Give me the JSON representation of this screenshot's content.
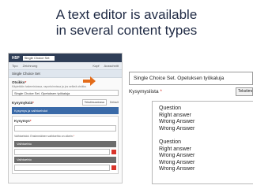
{
  "title": {
    "line1": "A text editor is available",
    "line2": "in several content types"
  },
  "thumbnail": {
    "logo": "H5P",
    "content_selector": "Single Choice Set",
    "toolbar": {
      "left": "Tipo",
      "middle": "Zeichnung",
      "right1": "Kopf",
      "right2": "Ausschnitt"
    },
    "header": "Single Choice Set",
    "title_label": "Otsikko",
    "title_hint": "Käytetään hakemistossa, raportoinnissa ja jos selkeä otsikko",
    "title_value": "Single Choice Set. Opetuksen työkaluja",
    "questions_label": "Kysymyksiä",
    "tab_text": "Tekstimuodossa",
    "tab_default": "Default",
    "question_bar": "Kysymys ja vaihtoehdot",
    "question_label": "Kysymys",
    "alternatives_note": "Vaihtoehdot. Ensimmäinen vaihtoehto on oikein.",
    "alt_label": "Vaihtoehto"
  },
  "zoom": {
    "title_value": "Single Choice Set. Opetuksen työkaluja",
    "label": "Kysymyslista",
    "tab_button": "Tekstimuodossa",
    "lines": [
      "Question",
      "Right answer",
      "Wrong Answer",
      "Wrong Answer",
      "",
      "Question",
      "Right answer",
      "Wrong Answer",
      "Wrong Answer",
      "Wrong Answer"
    ]
  },
  "colors": {
    "accent": "#e36c1a",
    "required": "#d9342b",
    "bar": "#3a6aa8"
  }
}
